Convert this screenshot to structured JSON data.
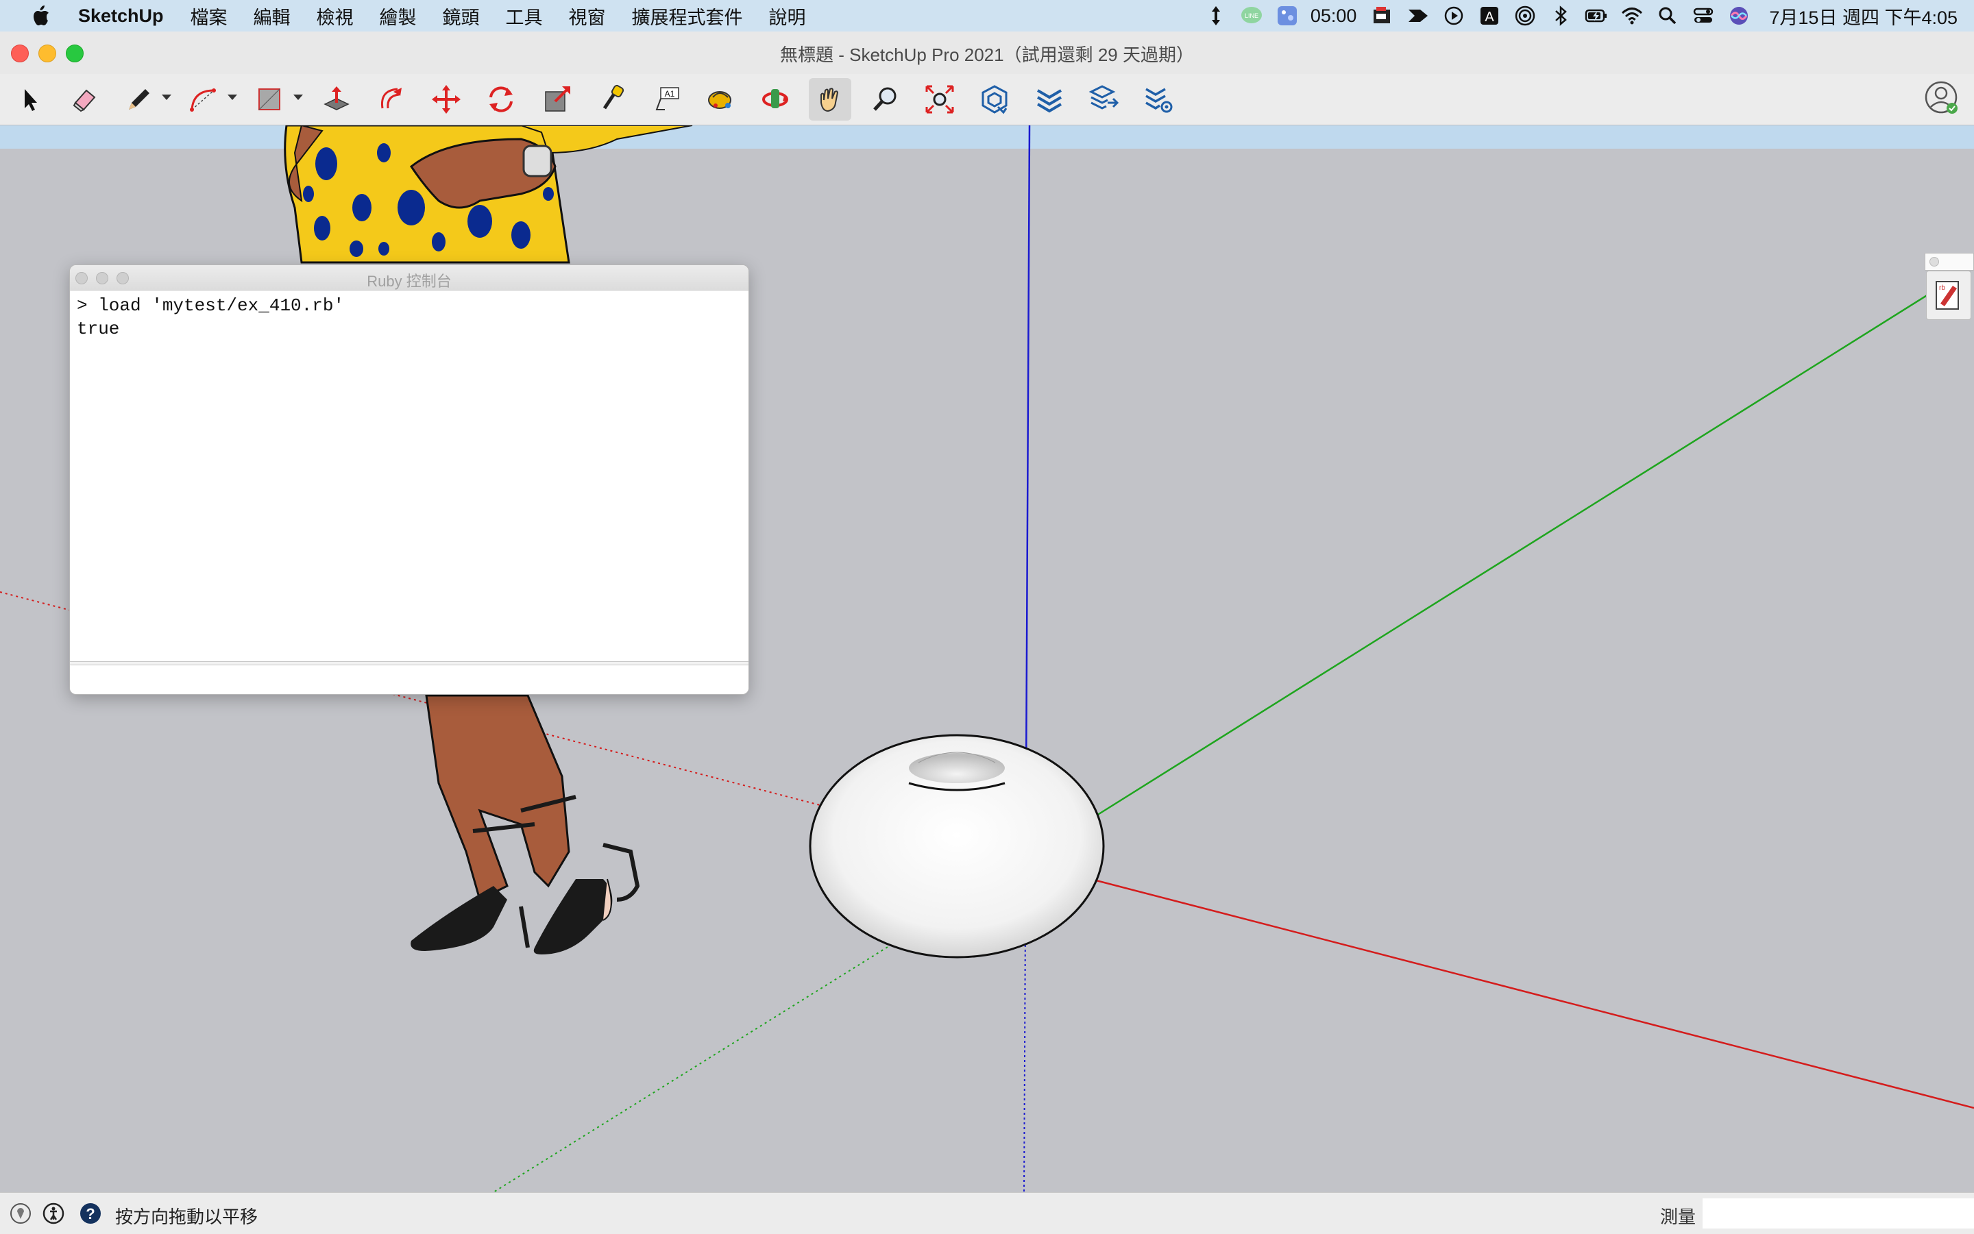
{
  "menubar": {
    "app_name": "SketchUp",
    "items": [
      "檔案",
      "編輯",
      "檢視",
      "繪製",
      "鏡頭",
      "工具",
      "視窗",
      "擴展程式套件",
      "說明"
    ],
    "status_time": "05:00",
    "clock": "7月15日 週四 下午4:05",
    "status_icons": [
      "arrow-updown-icon",
      "line-app-icon",
      "weather-icon",
      "screen-recorder-icon",
      "arrow-app-icon",
      "play-icon",
      "input-method-icon",
      "airdrop-icon",
      "bluetooth-icon",
      "battery-icon",
      "wifi-icon",
      "spotlight-icon",
      "control-center-icon",
      "siri-icon"
    ],
    "input_method_label": "A"
  },
  "window": {
    "title": "無標題 - SketchUp Pro 2021（試用還剩 29 天過期）"
  },
  "toolbar": {
    "tools": [
      "select-tool",
      "eraser-tool",
      "pencil-tool",
      "arc-tool",
      "rectangle-tool",
      "push-pull-tool",
      "offset-tool",
      "move-tool",
      "rotate-tool",
      "scale-tool",
      "tape-measure-tool",
      "text-tool",
      "paint-bucket-tool",
      "orbit-tool",
      "pan-tool",
      "zoom-tool",
      "zoom-extents-tool",
      "warehouse-tool",
      "extension-warehouse-tool",
      "sketchup-send-tool",
      "extension-manager-tool"
    ],
    "active_tool": "pan-tool"
  },
  "ruby_console": {
    "title": "Ruby 控制台",
    "output_line1": "> load 'mytest/ex_410.rb'",
    "output_line2": "true",
    "input_value": ""
  },
  "statusbar": {
    "message": "按方向拖動以平移",
    "measure_label": "測量",
    "measure_value": ""
  },
  "colors": {
    "sky": "#bfd9ee",
    "ground": "#c2c3c8",
    "axis_red": "#d41c1c",
    "axis_green": "#1ea51e",
    "axis_blue": "#1a1ad0"
  }
}
